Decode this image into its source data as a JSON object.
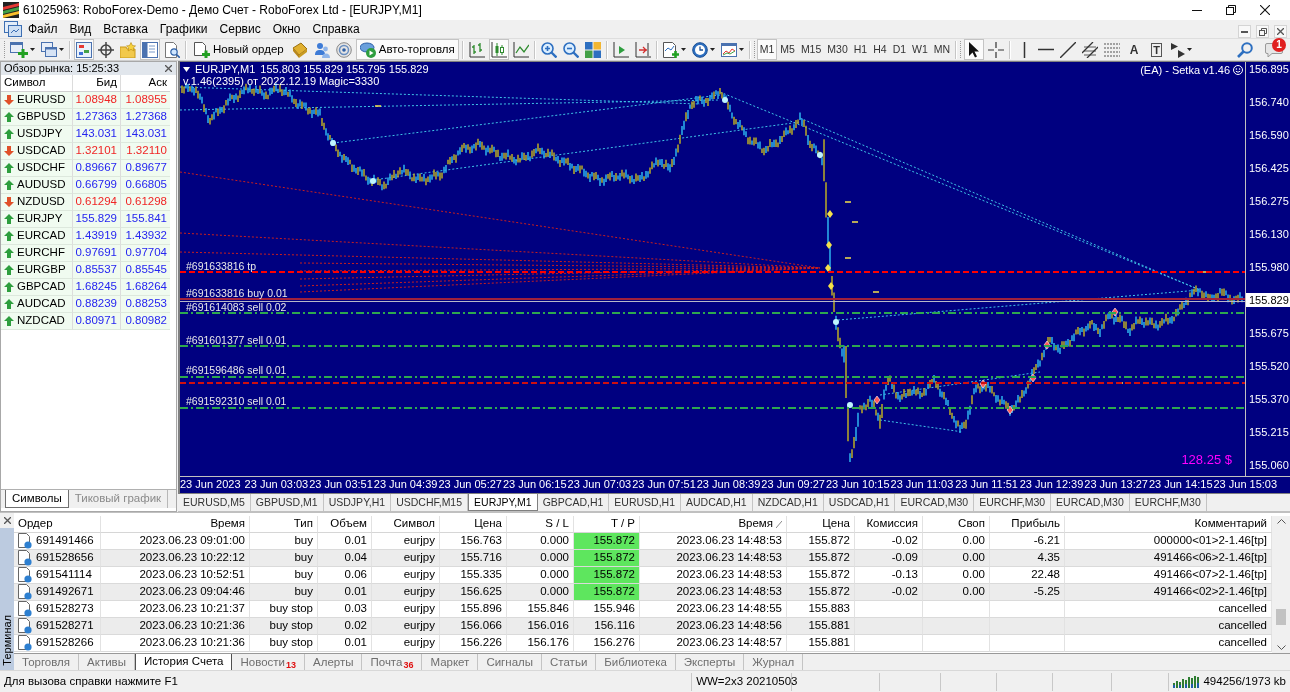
{
  "window": {
    "title": "61025963: RoboForex-Demo - Демо Счет - RoboForex Ltd - [EURJPY,M1]"
  },
  "menu": [
    "Файл",
    "Вид",
    "Вставка",
    "Графики",
    "Сервис",
    "Окно",
    "Справка"
  ],
  "toolbar": {
    "panels": [
      {
        "pressed": true
      },
      {
        "pressed": false
      },
      {
        "pressed": false
      },
      {
        "pressed": true
      },
      {
        "pressed": false
      }
    ],
    "new_order": "Новый ордер",
    "autotrading": {
      "label": "Авто-торговля",
      "on": true
    },
    "chart_types": [
      {
        "selected": false
      },
      {
        "selected": true
      },
      {
        "selected": false
      }
    ],
    "timeframes": [
      {
        "label": "M1",
        "selected": true
      },
      {
        "label": "M5",
        "selected": false
      },
      {
        "label": "M15",
        "selected": false
      },
      {
        "label": "M30",
        "selected": false
      },
      {
        "label": "H1",
        "selected": false
      },
      {
        "label": "H4",
        "selected": false
      },
      {
        "label": "D1",
        "selected": false
      },
      {
        "label": "W1",
        "selected": false
      },
      {
        "label": "MN",
        "selected": false
      }
    ],
    "drawing_tools": [
      {
        "kind": "cursor",
        "selected": true
      },
      {
        "kind": "crosshair",
        "selected": false
      },
      {
        "kind": "vline",
        "selected": false
      },
      {
        "kind": "hline",
        "selected": false
      },
      {
        "kind": "trendline",
        "selected": false
      },
      {
        "kind": "channel",
        "selected": false
      },
      {
        "kind": "fibonacci",
        "selected": false
      },
      {
        "kind": "text",
        "label": "A",
        "selected": false
      },
      {
        "kind": "label",
        "label": "T",
        "selected": false
      },
      {
        "kind": "arrows",
        "selected": false
      }
    ],
    "notifications": "1"
  },
  "market_watch": {
    "title": "Обзор рынка: 15:25:33",
    "columns": [
      "Символ",
      "Бид",
      "Аск"
    ],
    "rows": [
      {
        "symbol": "EURUSD",
        "bid": "1.08948",
        "ask": "1.08955",
        "rising": false
      },
      {
        "symbol": "GBPUSD",
        "bid": "1.27363",
        "ask": "1.27368",
        "rising": true
      },
      {
        "symbol": "USDJPY",
        "bid": "143.031",
        "ask": "143.031",
        "rising": true
      },
      {
        "symbol": "USDCAD",
        "bid": "1.32101",
        "ask": "1.32110",
        "rising": false
      },
      {
        "symbol": "USDCHF",
        "bid": "0.89667",
        "ask": "0.89677",
        "rising": true
      },
      {
        "symbol": "AUDUSD",
        "bid": "0.66799",
        "ask": "0.66805",
        "rising": true
      },
      {
        "symbol": "NZDUSD",
        "bid": "0.61294",
        "ask": "0.61298",
        "rising": false
      },
      {
        "symbol": "EURJPY",
        "bid": "155.829",
        "ask": "155.841",
        "rising": true
      },
      {
        "symbol": "EURCAD",
        "bid": "1.43919",
        "ask": "1.43932",
        "rising": true
      },
      {
        "symbol": "EURCHF",
        "bid": "0.97691",
        "ask": "0.97704",
        "rising": true
      },
      {
        "symbol": "EURGBP",
        "bid": "0.85537",
        "ask": "0.85545",
        "rising": true
      },
      {
        "symbol": "GBPCAD",
        "bid": "1.68245",
        "ask": "1.68264",
        "rising": true
      },
      {
        "symbol": "AUDCAD",
        "bid": "0.88239",
        "ask": "0.88253",
        "rising": true
      },
      {
        "symbol": "NZDCAD",
        "bid": "0.80971",
        "ask": "0.80982",
        "rising": true
      }
    ],
    "tabs": [
      {
        "label": "Символы",
        "selected": true
      },
      {
        "label": "Тиковый график",
        "selected": false
      }
    ]
  },
  "chart": {
    "symbol": "EURJPY,M1",
    "quote": "155.803 155.829 155.795 155.829",
    "info": "v.1.46(2395) от 2022.12.19 Magic=3330",
    "expert": "(EA) - Setka v1.46",
    "profit": "128.25 $",
    "order_lines": [
      {
        "kind": "tp",
        "label": "#691633816 tp",
        "color": "#ff0000"
      },
      {
        "kind": "buy",
        "label": "#691633816 buy 0.01",
        "color": "#a0203c"
      },
      {
        "kind": "sell",
        "label": "#691614083 sell 0.02",
        "color": "#2ea84f"
      },
      {
        "kind": "sell",
        "label": "#691601377 sell 0.01",
        "color": "#2ea84f"
      },
      {
        "kind": "sell",
        "label": "#691596486 sell 0.01",
        "color": "#2ea84f"
      },
      {
        "kind": "tp",
        "color": "#d01010"
      },
      {
        "kind": "sell",
        "label": "#691592310 sell 0.01",
        "color": "#2ea84f"
      }
    ],
    "price_axis": [
      {
        "text": "156.895",
        "current": false
      },
      {
        "text": "156.740",
        "current": false
      },
      {
        "text": "156.590",
        "current": false
      },
      {
        "text": "156.425",
        "current": false
      },
      {
        "text": "156.275",
        "current": false
      },
      {
        "text": "156.130",
        "current": false
      },
      {
        "text": "155.980",
        "current": false
      },
      {
        "text": "155.829",
        "current": true
      },
      {
        "text": "155.675",
        "current": false
      },
      {
        "text": "155.520",
        "current": false
      },
      {
        "text": "155.370",
        "current": false
      },
      {
        "text": "155.215",
        "current": false
      },
      {
        "text": "155.060",
        "current": false
      }
    ],
    "time_axis": [
      "23 Jun 2023",
      "23 Jun 03:03",
      "23 Jun 03:51",
      "23 Jun 04:39",
      "23 Jun 05:27",
      "23 Jun 06:15",
      "23 Jun 07:03",
      "23 Jun 07:51",
      "23 Jun 08:39",
      "23 Jun 09:27",
      "23 Jun 10:15",
      "23 Jun 11:03",
      "23 Jun 11:51",
      "23 Jun 12:39",
      "23 Jun 13:27",
      "23 Jun 14:15",
      "23 Jun 15:03"
    ]
  },
  "chart_tabs": [
    {
      "label": "EURUSD,M5",
      "selected": false
    },
    {
      "label": "GBPUSD,M1",
      "selected": false
    },
    {
      "label": "USDJPY,H1",
      "selected": false
    },
    {
      "label": "USDCHF,M15",
      "selected": false
    },
    {
      "label": "EURJPY,M1",
      "selected": true
    },
    {
      "label": "GBPCAD,H1",
      "selected": false
    },
    {
      "label": "EURUSD,H1",
      "selected": false
    },
    {
      "label": "AUDCAD,H1",
      "selected": false
    },
    {
      "label": "NZDCAD,H1",
      "selected": false
    },
    {
      "label": "USDCAD,H1",
      "selected": false
    },
    {
      "label": "EURCAD,M30",
      "selected": false
    },
    {
      "label": "EURCHF,M30",
      "selected": false
    },
    {
      "label": "EURCAD,M30",
      "selected": false
    },
    {
      "label": "EURCHF,M30",
      "selected": false
    }
  ],
  "terminal": {
    "title": "Терминал",
    "columns": [
      {
        "label": "Ордер",
        "sorted": false
      },
      {
        "label": "Время",
        "sorted": false
      },
      {
        "label": "Тип",
        "sorted": false
      },
      {
        "label": "Объем",
        "sorted": false
      },
      {
        "label": "Символ",
        "sorted": false
      },
      {
        "label": "Цена",
        "sorted": false
      },
      {
        "label": "S / L",
        "sorted": false
      },
      {
        "label": "T / P",
        "sorted": false
      },
      {
        "label": "Время",
        "sorted": true
      },
      {
        "label": "Цена",
        "sorted": false
      },
      {
        "label": "Комиссия",
        "sorted": false
      },
      {
        "label": "Своп",
        "sorted": false
      },
      {
        "label": "Прибыль",
        "sorted": false
      },
      {
        "label": "Комментарий",
        "sorted": false
      }
    ],
    "rows": [
      {
        "order": "691491466",
        "open_time": "2023.06.23 09:01:00",
        "type": "buy",
        "volume": "0.01",
        "symbol": "eurjpy",
        "price": "156.763",
        "sl": "0.000",
        "tp": "155.872",
        "tp_hit": true,
        "close_time": "2023.06.23 14:48:53",
        "close_price": "155.872",
        "commission": "-0.02",
        "swap": "0.00",
        "profit": "-6.21",
        "comment": "000000<01>2-1.46[tp]"
      },
      {
        "order": "691528656",
        "open_time": "2023.06.23 10:22:12",
        "type": "buy",
        "volume": "0.04",
        "symbol": "eurjpy",
        "price": "155.716",
        "sl": "0.000",
        "tp": "155.872",
        "tp_hit": true,
        "close_time": "2023.06.23 14:48:53",
        "close_price": "155.872",
        "commission": "-0.09",
        "swap": "0.00",
        "profit": "4.35",
        "comment": "491466<06>2-1.46[tp]"
      },
      {
        "order": "691541114",
        "open_time": "2023.06.23 10:52:51",
        "type": "buy",
        "volume": "0.06",
        "symbol": "eurjpy",
        "price": "155.335",
        "sl": "0.000",
        "tp": "155.872",
        "tp_hit": true,
        "close_time": "2023.06.23 14:48:53",
        "close_price": "155.872",
        "commission": "-0.13",
        "swap": "0.00",
        "profit": "22.48",
        "comment": "491466<07>2-1.46[tp]"
      },
      {
        "order": "691492671",
        "open_time": "2023.06.23 09:04:46",
        "type": "buy",
        "volume": "0.01",
        "symbol": "eurjpy",
        "price": "156.625",
        "sl": "0.000",
        "tp": "155.872",
        "tp_hit": true,
        "close_time": "2023.06.23 14:48:53",
        "close_price": "155.872",
        "commission": "-0.02",
        "swap": "0.00",
        "profit": "-5.25",
        "comment": "491466<02>2-1.46[tp]"
      },
      {
        "order": "691528273",
        "open_time": "2023.06.23 10:21:37",
        "type": "buy stop",
        "volume": "0.03",
        "symbol": "eurjpy",
        "price": "155.896",
        "sl": "155.846",
        "tp": "155.946",
        "tp_hit": false,
        "close_time": "2023.06.23 14:48:55",
        "close_price": "155.883",
        "comment": "cancelled"
      },
      {
        "order": "691528271",
        "open_time": "2023.06.23 10:21:36",
        "type": "buy stop",
        "volume": "0.02",
        "symbol": "eurjpy",
        "price": "156.066",
        "sl": "156.016",
        "tp": "156.116",
        "tp_hit": false,
        "close_time": "2023.06.23 14:48:56",
        "close_price": "155.881",
        "comment": "cancelled"
      },
      {
        "order": "691528266",
        "open_time": "2023.06.23 10:21:36",
        "type": "buy stop",
        "volume": "0.01",
        "symbol": "eurjpy",
        "price": "156.226",
        "sl": "156.176",
        "tp": "156.276",
        "tp_hit": false,
        "close_time": "2023.06.23 14:48:57",
        "close_price": "155.881",
        "comment": "cancelled"
      }
    ],
    "tabs": [
      {
        "label": "Торговля",
        "selected": false
      },
      {
        "label": "Активы",
        "selected": false
      },
      {
        "label": "История Счета",
        "selected": true
      },
      {
        "label": "Новости",
        "count": "13",
        "selected": false
      },
      {
        "label": "Алерты",
        "selected": false
      },
      {
        "label": "Почта",
        "count": "36",
        "selected": false
      },
      {
        "label": "Маркет",
        "selected": false
      },
      {
        "label": "Сигналы",
        "selected": false
      },
      {
        "label": "Статьи",
        "selected": false
      },
      {
        "label": "Библиотека",
        "selected": false
      },
      {
        "label": "Эксперты",
        "selected": false
      },
      {
        "label": "Журнал",
        "selected": false
      }
    ]
  },
  "status_bar": {
    "help": "Для вызова справки нажмите F1",
    "build": "WW=2x3 20210503",
    "traffic": "494256/1973 kb"
  }
}
